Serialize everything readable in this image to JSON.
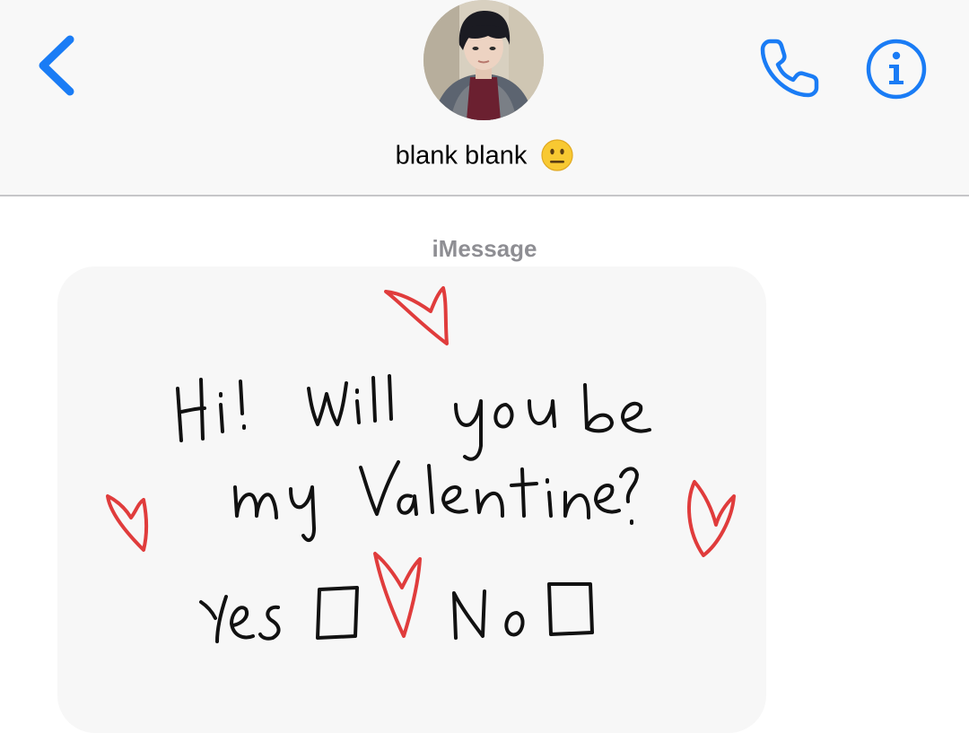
{
  "header": {
    "contact_name": "blank blank",
    "emoji": "neutral-face",
    "accent_color": "#1a7cf5"
  },
  "conversation": {
    "service_label": "iMessage"
  },
  "message": {
    "type": "handwritten-image",
    "ink_color": "#111111",
    "heart_color": "#e03c3c",
    "text_lines": [
      "Hi! Will you be",
      "my Valentine?",
      "Yes",
      "No"
    ]
  }
}
